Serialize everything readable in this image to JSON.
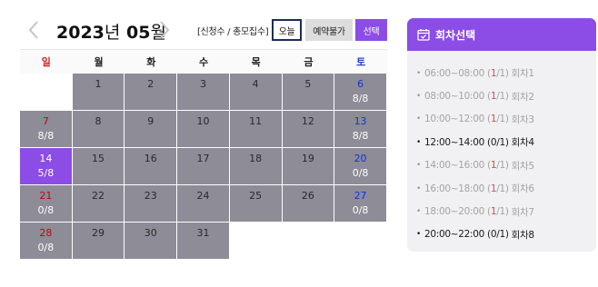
{
  "calendar": {
    "year": "2023",
    "year_unit": "년",
    "month": "05",
    "month_unit": "월",
    "count_label": "[신청수 / 총모집수]",
    "legend": {
      "today": "오늘",
      "unavailable": "예약불가",
      "selected": "선택"
    },
    "weekdays": [
      "일",
      "월",
      "화",
      "수",
      "목",
      "금",
      "토"
    ],
    "weeks": [
      [
        {
          "day": "",
          "count": "",
          "state": "blank"
        },
        {
          "day": "1",
          "count": "",
          "state": "unavailable"
        },
        {
          "day": "2",
          "count": "",
          "state": "unavailable"
        },
        {
          "day": "3",
          "count": "",
          "state": "unavailable"
        },
        {
          "day": "4",
          "count": "",
          "state": "unavailable"
        },
        {
          "day": "5",
          "count": "",
          "state": "unavailable"
        },
        {
          "day": "6",
          "count": "8/8",
          "state": "unavailable"
        }
      ],
      [
        {
          "day": "7",
          "count": "8/8",
          "state": "unavailable"
        },
        {
          "day": "8",
          "count": "",
          "state": "unavailable"
        },
        {
          "day": "9",
          "count": "",
          "state": "unavailable"
        },
        {
          "day": "10",
          "count": "",
          "state": "unavailable"
        },
        {
          "day": "11",
          "count": "",
          "state": "unavailable"
        },
        {
          "day": "12",
          "count": "",
          "state": "unavailable"
        },
        {
          "day": "13",
          "count": "8/8",
          "state": "unavailable"
        }
      ],
      [
        {
          "day": "14",
          "count": "5/8",
          "state": "selected"
        },
        {
          "day": "15",
          "count": "",
          "state": "unavailable"
        },
        {
          "day": "16",
          "count": "",
          "state": "unavailable"
        },
        {
          "day": "17",
          "count": "",
          "state": "unavailable"
        },
        {
          "day": "18",
          "count": "",
          "state": "unavailable"
        },
        {
          "day": "19",
          "count": "",
          "state": "unavailable"
        },
        {
          "day": "20",
          "count": "0/8",
          "state": "unavailable"
        }
      ],
      [
        {
          "day": "21",
          "count": "0/8",
          "state": "unavailable"
        },
        {
          "day": "22",
          "count": "",
          "state": "unavailable"
        },
        {
          "day": "23",
          "count": "",
          "state": "unavailable"
        },
        {
          "day": "24",
          "count": "",
          "state": "unavailable"
        },
        {
          "day": "25",
          "count": "",
          "state": "unavailable"
        },
        {
          "day": "26",
          "count": "",
          "state": "unavailable"
        },
        {
          "day": "27",
          "count": "0/8",
          "state": "unavailable"
        }
      ],
      [
        {
          "day": "28",
          "count": "0/8",
          "state": "unavailable"
        },
        {
          "day": "29",
          "count": "",
          "state": "unavailable"
        },
        {
          "day": "30",
          "count": "",
          "state": "unavailable"
        },
        {
          "day": "31",
          "count": "",
          "state": "unavailable"
        },
        {
          "day": "",
          "count": "",
          "state": "blank"
        },
        {
          "day": "",
          "count": "",
          "state": "blank"
        },
        {
          "day": "",
          "count": "",
          "state": "blank"
        }
      ]
    ]
  },
  "sessions_panel": {
    "title": "회차선택",
    "icon": "calendar-check-icon",
    "sessions": [
      {
        "time": "06:00~08:00",
        "used": "1",
        "total": "1",
        "name": "회차1",
        "available": false
      },
      {
        "time": "08:00~10:00",
        "used": "1",
        "total": "1",
        "name": "회차2",
        "available": false
      },
      {
        "time": "10:00~12:00",
        "used": "1",
        "total": "1",
        "name": "회차3",
        "available": false
      },
      {
        "time": "12:00~14:00",
        "used": "0",
        "total": "1",
        "name": "회차4",
        "available": true
      },
      {
        "time": "14:00~16:00",
        "used": "1",
        "total": "1",
        "name": "회차5",
        "available": false
      },
      {
        "time": "16:00~18:00",
        "used": "1",
        "total": "1",
        "name": "회차6",
        "available": false
      },
      {
        "time": "18:00~20:00",
        "used": "1",
        "total": "1",
        "name": "회차7",
        "available": false
      },
      {
        "time": "20:00~22:00",
        "used": "0",
        "total": "1",
        "name": "회차8",
        "available": true
      }
    ]
  },
  "colors": {
    "accent": "#8c4ce6",
    "unavailable_cell": "#8d8c97",
    "sunday": "#d32424",
    "saturday": "#2345c4",
    "today_border": "#1c2d5a"
  }
}
